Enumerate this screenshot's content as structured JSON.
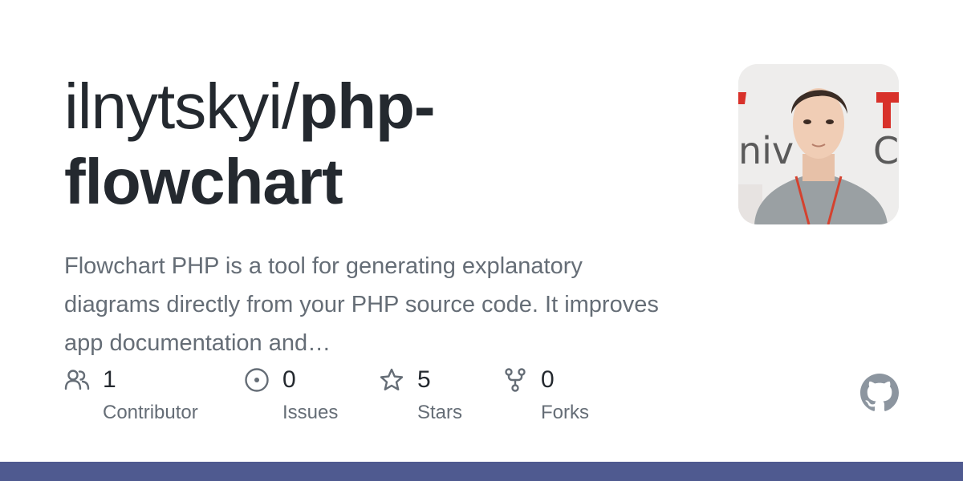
{
  "repo": {
    "owner": "ilnytskyi/",
    "name": "php-flowchart",
    "description": "Flowchart PHP is a tool for generating explanatory diagrams directly from your PHP source code. It improves app documentation and…"
  },
  "avatar": {
    "alt": "owner avatar"
  },
  "stats": {
    "contributors": {
      "value": "1",
      "label": "Contributor",
      "icon": "people-icon"
    },
    "issues": {
      "value": "0",
      "label": "Issues",
      "icon": "issue-opened-icon"
    },
    "stars": {
      "value": "5",
      "label": "Stars",
      "icon": "star-icon"
    },
    "forks": {
      "value": "0",
      "label": "Forks",
      "icon": "repo-forked-icon"
    }
  },
  "colors": {
    "text_primary": "#24292f",
    "text_secondary": "#656d76",
    "bottom_bar": "#4f5a90"
  }
}
